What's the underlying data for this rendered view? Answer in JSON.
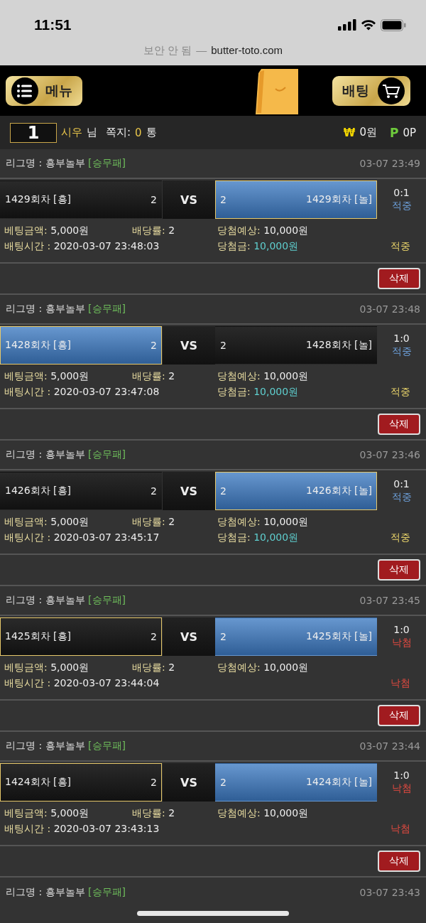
{
  "status_bar": {
    "time": "11:51"
  },
  "browser": {
    "security": "보안 안 됨",
    "separator": "—",
    "url": "butter-toto.com"
  },
  "header": {
    "menu_label": "메뉴",
    "bet_label": "배팅"
  },
  "user_bar": {
    "level": "1",
    "name": "시우",
    "honorific": "님",
    "messages_label": "쪽지:",
    "messages_count": "0",
    "messages_unit": "통",
    "money_symbol": "₩",
    "money": "0원",
    "points_symbol": "P",
    "points": "0P"
  },
  "bets": [
    {
      "league": "리그명 : 흥부놀부",
      "game_type": "[승무패]",
      "date": "03-07 23:49",
      "home": {
        "label": "1429회차 [흥]",
        "odds": "2",
        "selected": false,
        "winner": false
      },
      "vs": "VS",
      "away": {
        "label": "1429회차 [놀]",
        "odds": "2",
        "selected": true,
        "winner": true
      },
      "score": "0:1",
      "result": "적중",
      "kind": "hit",
      "amount_label": "베팅금액:",
      "amount": "5,000원",
      "odds_label": "배당률:",
      "odds": "2",
      "expected_label": "당첨예상:",
      "expected": "10,000원",
      "time_label": "배팅시간 :",
      "time": "2020-03-07 23:48:03",
      "payout_label": "당첨금:",
      "payout": "10,000원",
      "status": "적중",
      "delete": "삭제"
    },
    {
      "league": "리그명 : 흥부놀부",
      "game_type": "[승무패]",
      "date": "03-07 23:48",
      "home": {
        "label": "1428회차 [흥]",
        "odds": "2",
        "selected": true,
        "winner": true
      },
      "vs": "VS",
      "away": {
        "label": "1428회차 [놀]",
        "odds": "2",
        "selected": false,
        "winner": false
      },
      "score": "1:0",
      "result": "적중",
      "kind": "hit",
      "amount_label": "베팅금액:",
      "amount": "5,000원",
      "odds_label": "배당률:",
      "odds": "2",
      "expected_label": "당첨예상:",
      "expected": "10,000원",
      "time_label": "배팅시간 :",
      "time": "2020-03-07 23:47:08",
      "payout_label": "당첨금:",
      "payout": "10,000원",
      "status": "적중",
      "delete": "삭제"
    },
    {
      "league": "리그명 : 흥부놀부",
      "game_type": "[승무패]",
      "date": "03-07 23:46",
      "home": {
        "label": "1426회차 [흥]",
        "odds": "2",
        "selected": false,
        "winner": false
      },
      "vs": "VS",
      "away": {
        "label": "1426회차 [놀]",
        "odds": "2",
        "selected": true,
        "winner": true
      },
      "score": "0:1",
      "result": "적중",
      "kind": "hit",
      "amount_label": "베팅금액:",
      "amount": "5,000원",
      "odds_label": "배당률:",
      "odds": "2",
      "expected_label": "당첨예상:",
      "expected": "10,000원",
      "time_label": "배팅시간 :",
      "time": "2020-03-07 23:45:17",
      "payout_label": "당첨금:",
      "payout": "10,000원",
      "status": "적중",
      "delete": "삭제"
    },
    {
      "league": "리그명 : 흥부놀부",
      "game_type": "[승무패]",
      "date": "03-07 23:45",
      "home": {
        "label": "1425회차 [흥]",
        "odds": "2",
        "selected": true,
        "winner": false
      },
      "vs": "VS",
      "away": {
        "label": "1425회차 [놀]",
        "odds": "2",
        "selected": false,
        "winner": true
      },
      "score": "1:0",
      "result": "낙첨",
      "kind": "miss",
      "amount_label": "베팅금액:",
      "amount": "5,000원",
      "odds_label": "배당률:",
      "odds": "2",
      "expected_label": "당첨예상:",
      "expected": "10,000원",
      "time_label": "배팅시간 :",
      "time": "2020-03-07 23:44:04",
      "status": "낙첨",
      "delete": "삭제"
    },
    {
      "league": "리그명 : 흥부놀부",
      "game_type": "[승무패]",
      "date": "03-07 23:44",
      "home": {
        "label": "1424회차 [흥]",
        "odds": "2",
        "selected": true,
        "winner": false
      },
      "vs": "VS",
      "away": {
        "label": "1424회차 [놀]",
        "odds": "2",
        "selected": false,
        "winner": true
      },
      "score": "1:0",
      "result": "낙첨",
      "kind": "miss",
      "amount_label": "베팅금액:",
      "amount": "5,000원",
      "odds_label": "배당률:",
      "odds": "2",
      "expected_label": "당첨예상:",
      "expected": "10,000원",
      "time_label": "배팅시간 :",
      "time": "2020-03-07 23:43:13",
      "status": "낙첨",
      "delete": "삭제"
    }
  ],
  "next_bet": {
    "league": "리그명 : 흥부놀부",
    "game_type": "[승무패]",
    "date": "03-07 23:43"
  }
}
